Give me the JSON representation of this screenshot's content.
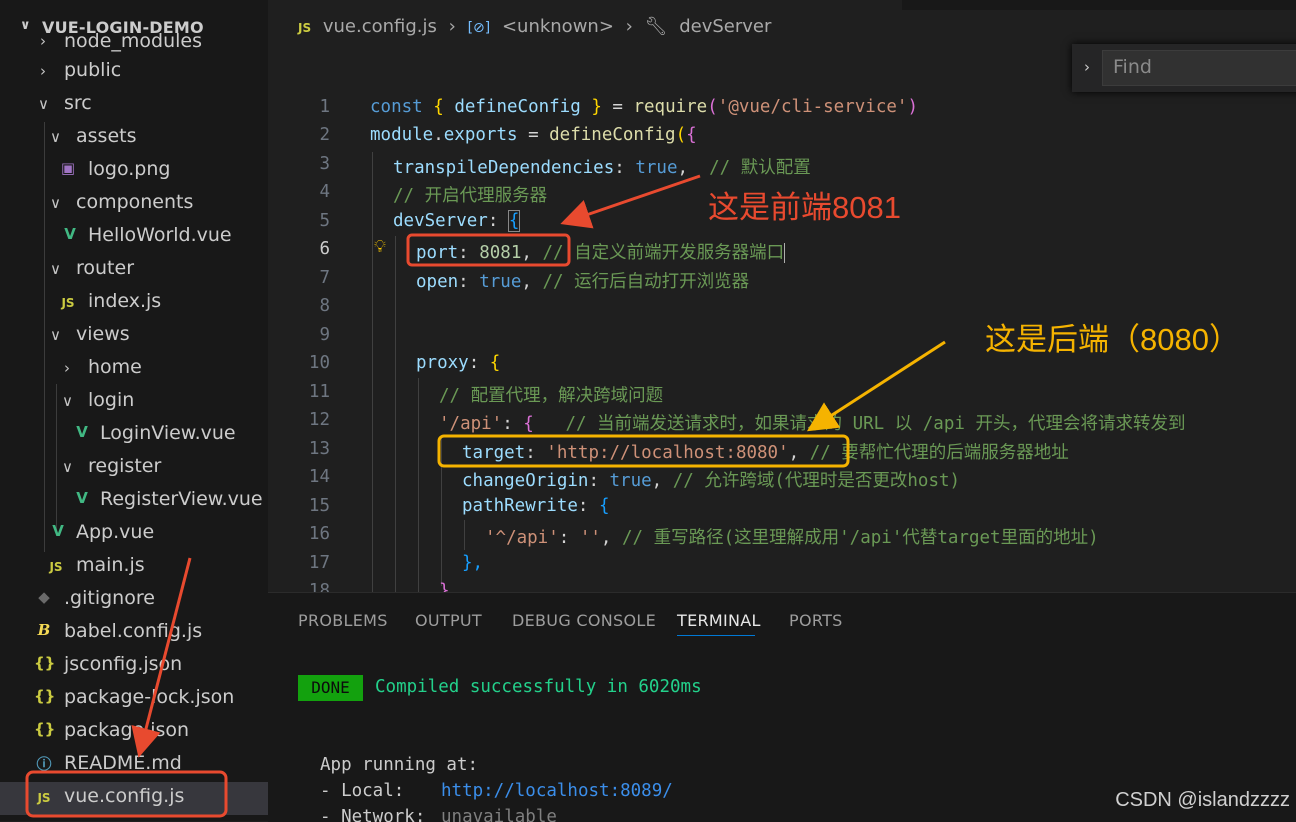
{
  "explorer": {
    "title": "VUE-LOGIN-DEMO",
    "items": [
      {
        "label": "node_modules",
        "type": "folder",
        "collapsed": true
      },
      {
        "label": "public",
        "type": "folder",
        "collapsed": true
      },
      {
        "label": "src",
        "type": "folder",
        "collapsed": false
      },
      {
        "label": "assets",
        "type": "folder",
        "collapsed": false
      },
      {
        "label": "logo.png",
        "type": "image"
      },
      {
        "label": "components",
        "type": "folder",
        "collapsed": false
      },
      {
        "label": "HelloWorld.vue",
        "type": "vue"
      },
      {
        "label": "router",
        "type": "folder",
        "collapsed": false
      },
      {
        "label": "index.js",
        "type": "js"
      },
      {
        "label": "views",
        "type": "folder",
        "collapsed": false
      },
      {
        "label": "home",
        "type": "folder",
        "collapsed": true
      },
      {
        "label": "login",
        "type": "folder",
        "collapsed": false
      },
      {
        "label": "LoginView.vue",
        "type": "vue"
      },
      {
        "label": "register",
        "type": "folder",
        "collapsed": false
      },
      {
        "label": "RegisterView.vue",
        "type": "vue"
      },
      {
        "label": "App.vue",
        "type": "vue"
      },
      {
        "label": "main.js",
        "type": "js"
      },
      {
        "label": ".gitignore",
        "type": "git"
      },
      {
        "label": "babel.config.js",
        "type": "babel"
      },
      {
        "label": "jsconfig.json",
        "type": "json"
      },
      {
        "label": "package-lock.json",
        "type": "json"
      },
      {
        "label": "package.json",
        "type": "json"
      },
      {
        "label": "README.md",
        "type": "info"
      },
      {
        "label": "vue.config.js",
        "type": "js",
        "selected": true
      }
    ]
  },
  "icons": {
    "js": "JS",
    "vue": "V",
    "json": "{}",
    "image": "image-icon",
    "git": "diamond-icon",
    "babel": "B",
    "info": "info-icon"
  },
  "breadcrumb": {
    "file": "vue.config.js",
    "scope": "<unknown>",
    "symbol": "devServer",
    "file_icon": "JS"
  },
  "find": {
    "placeholder": "Find"
  },
  "editor": {
    "current_line": 6,
    "lines": [
      {
        "n": "1",
        "text": "const { defineConfig } = require('@vue/cli-service')"
      },
      {
        "n": "2",
        "text": "module.exports = defineConfig({"
      },
      {
        "n": "3",
        "text": "transpileDependencies: true,  // 默认配置"
      },
      {
        "n": "4",
        "text": "// 开启代理服务器"
      },
      {
        "n": "5",
        "text": "devServer: {"
      },
      {
        "n": "6",
        "text": "port: 8081, // 自定义前端开发服务器端口"
      },
      {
        "n": "7",
        "text": "open: true, // 运行后自动打开浏览器"
      },
      {
        "n": "8",
        "text": ""
      },
      {
        "n": "9",
        "text": ""
      },
      {
        "n": "10",
        "text": "proxy: {"
      },
      {
        "n": "11",
        "text": "// 配置代理，解决跨域问题"
      },
      {
        "n": "12",
        "text": "'/api': {   // 当前端发送请求时，如果请求的 URL 以 /api 开头，代理会将请求转发到"
      },
      {
        "n": "13",
        "text": "target: 'http://localhost:8080', // 要帮忙代理的后端服务器地址"
      },
      {
        "n": "14",
        "text": "changeOrigin: true, // 允许跨域(代理时是否更改host)"
      },
      {
        "n": "15",
        "text": "pathRewrite: {"
      },
      {
        "n": "16",
        "text": "'^/api': '', // 重写路径(这里理解成用'/api'代替target里面的地址)"
      },
      {
        "n": "17",
        "text": "},"
      },
      {
        "n": "18",
        "text": "}"
      }
    ]
  },
  "panel": {
    "tabs": [
      "PROBLEMS",
      "OUTPUT",
      "DEBUG CONSOLE",
      "TERMINAL",
      "PORTS"
    ],
    "active_tab": "TERMINAL",
    "terminal": {
      "badge": "DONE",
      "compiled": "Compiled successfully in 6020ms",
      "running": "App running at:",
      "local_label": "- Local:",
      "local_url": "http://localhost:8089/",
      "network_label": "- Network:",
      "network_value": "unavailable"
    }
  },
  "annotations": {
    "frontend": "这是前端8081",
    "backend": "这是后端（8080）"
  },
  "watermark": "CSDN @islandzzzz",
  "colors": {
    "red_annotation": "#e84a2f",
    "yellow_annotation": "#f5b300",
    "done_badge": "#13a10e"
  }
}
